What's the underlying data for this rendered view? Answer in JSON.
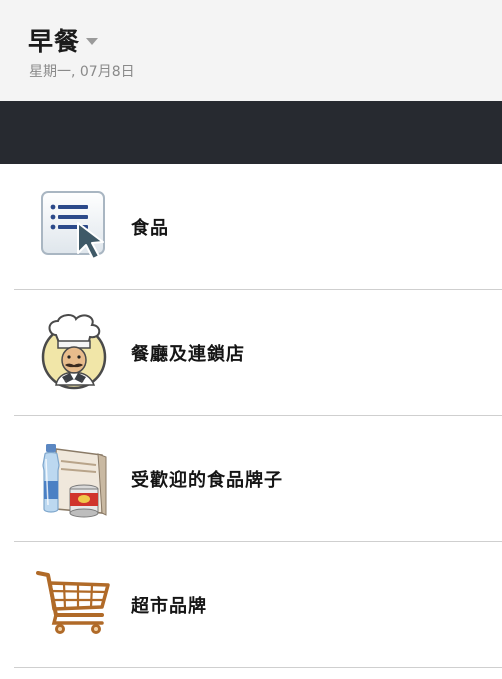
{
  "header": {
    "title": "早餐",
    "subtitle": "星期一, 07月8日"
  },
  "menu": {
    "items": [
      {
        "label": "食品",
        "icon": "food-list-cursor-icon"
      },
      {
        "label": "餐廳及連鎖店",
        "icon": "chef-icon"
      },
      {
        "label": "受歡迎的食品牌子",
        "icon": "food-brands-icon"
      },
      {
        "label": "超市品牌",
        "icon": "shopping-cart-icon"
      }
    ]
  }
}
